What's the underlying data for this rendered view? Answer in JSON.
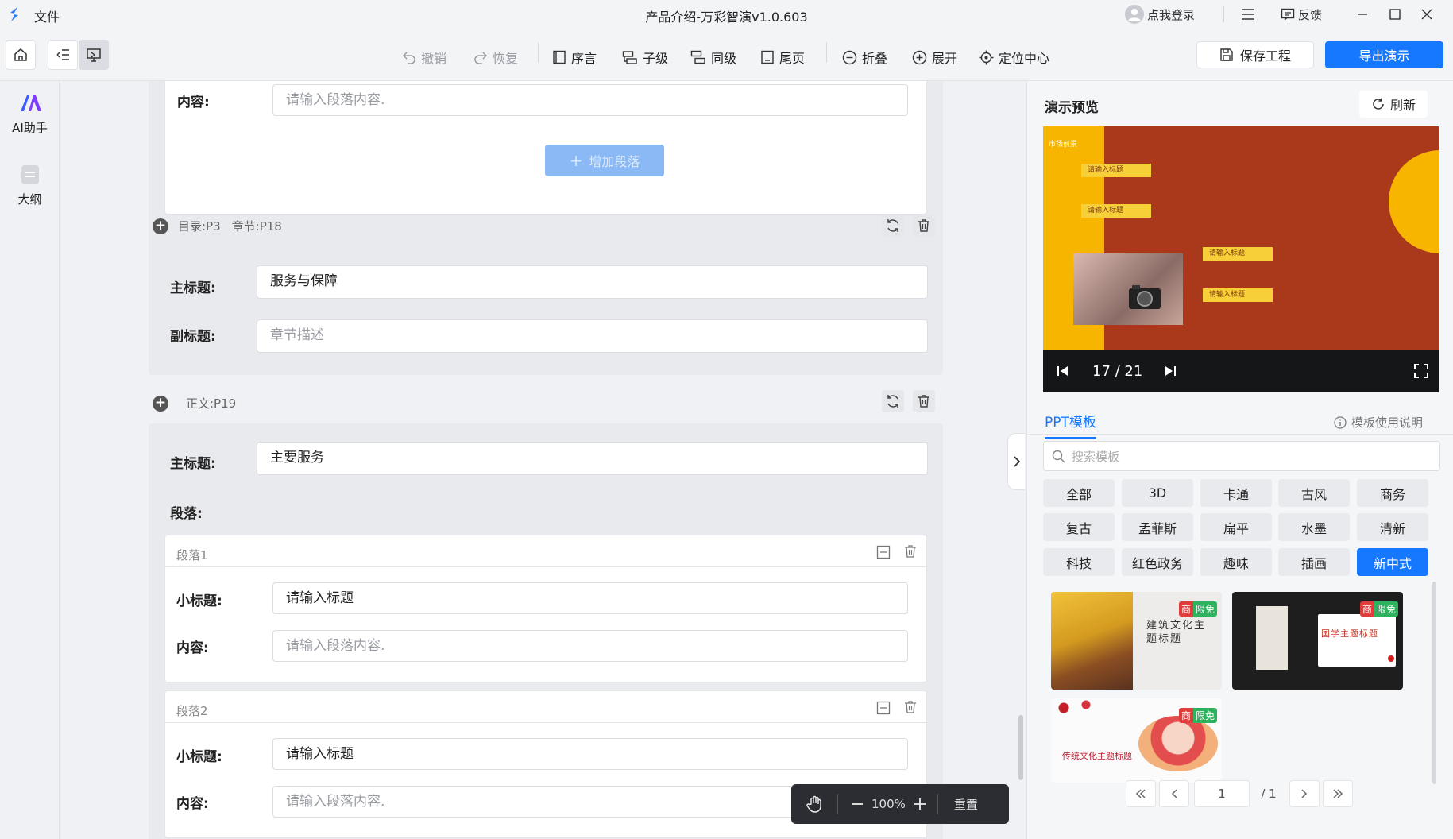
{
  "app": {
    "menu_file": "文件",
    "title": "产品介绍-万彩智演v1.0.603",
    "login": "点我登录",
    "feedback": "反馈"
  },
  "toolbar": {
    "undo": "撤销",
    "redo": "恢复",
    "preface": "序言",
    "child": "子级",
    "sibling": "同级",
    "endpage": "尾页",
    "fold": "折叠",
    "expand": "展开",
    "locate": "定位中心",
    "save": "保存工程",
    "export": "导出演示"
  },
  "sidebar": {
    "items": [
      {
        "label": "AI助手",
        "icon": "ai-assistant-icon"
      },
      {
        "label": "大纲",
        "icon": "outline-icon"
      }
    ]
  },
  "editor": {
    "top": {
      "content_label": "内容:",
      "content_placeholder": "请输入段落内容.",
      "add_paragraph": "增加段落"
    },
    "section1": {
      "header_dir": "目录:P3",
      "header_chapter": "章节:P18",
      "main_label": "主标题:",
      "main_value": "服务与保障",
      "sub_label": "副标题:",
      "sub_placeholder": "章节描述"
    },
    "section2": {
      "header": "正文:P19",
      "main_label": "主标题:",
      "main_value": "主要服务",
      "paragraphs_label": "段落:",
      "paragraphs": [
        {
          "title": "段落1",
          "subtitle_label": "小标题:",
          "subtitle_value": "请输入标题",
          "content_label": "内容:",
          "content_placeholder": "请输入段落内容."
        },
        {
          "title": "段落2",
          "subtitle_label": "小标题:",
          "subtitle_value": "请输入标题",
          "content_label": "内容:",
          "content_placeholder": "请输入段落内容."
        }
      ]
    }
  },
  "zoom": {
    "value": "100%",
    "reset": "重置"
  },
  "preview": {
    "title": "演示预览",
    "refresh": "刷新",
    "page_counter": "17 / 21",
    "slide": {
      "category": "市场前景",
      "labels": [
        "请输入标题",
        "请输入标题",
        "请输入标题",
        "请输入标题"
      ],
      "bg": "#a9391a",
      "accent": "#f7b500"
    }
  },
  "templates": {
    "tab": "PPT模板",
    "help": "模板使用说明",
    "search_placeholder": "搜索模板",
    "categories": [
      "全部",
      "3D",
      "卡通",
      "古风",
      "商务",
      "复古",
      "孟菲斯",
      "扁平",
      "水墨",
      "清新",
      "科技",
      "红色政务",
      "趣味",
      "插画",
      "新中式"
    ],
    "selected": "新中式",
    "badge_commercial": "商",
    "badge_free": "限免",
    "cards": [
      {
        "text": "建筑文化主题标题"
      },
      {
        "text": "国学主题标题"
      },
      {
        "text": "传统文化主题标题"
      }
    ],
    "pager": {
      "current": "1",
      "total": "/ 1"
    }
  },
  "colors": {
    "accent": "#1677ff",
    "selected_chip": "#1677ff"
  }
}
